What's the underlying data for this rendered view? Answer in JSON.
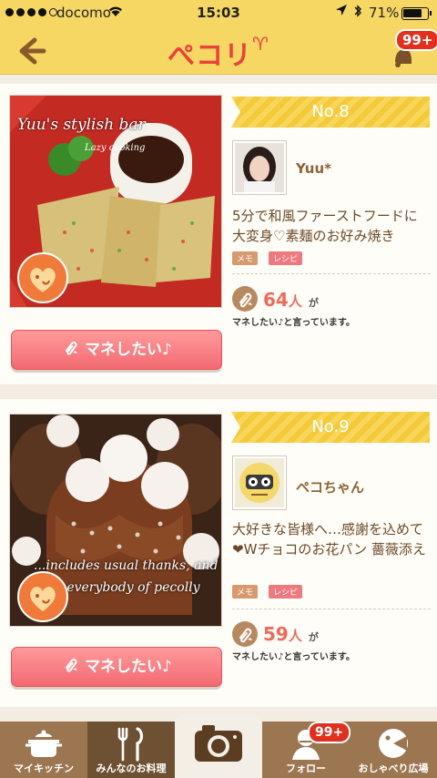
{
  "status_bar": {
    "carrier": "docomo",
    "time": "15:03",
    "battery": "71%"
  },
  "nav": {
    "logo": "ぺコリ",
    "notification_badge": "99+"
  },
  "posts": [
    {
      "rank": "No.8",
      "user": "Yuu*",
      "title": "5分で和風ファーストフードに大変身♡素麺のお好み焼き",
      "tag_memo": "メモ",
      "tag_recipe": "レシピ",
      "count": "64",
      "count_unit": "人",
      "count_suffix": "が",
      "count_text": "マネしたい♪と言っています。",
      "button_label": "マネしたい♪",
      "photo_caption_1": "Yuu's stylish bar",
      "photo_caption_2": "Lazy cooking"
    },
    {
      "rank": "No.9",
      "user": "ペコちゃん",
      "title": "大好きな皆様へ…感謝を込めて❤Wチョコのお花パン 薔薇添え",
      "tag_memo": "メモ",
      "tag_recipe": "レシピ",
      "count": "59",
      "count_unit": "人",
      "count_suffix": "が",
      "count_text": "マネしたい♪と言っています。",
      "button_label": "マネしたい♪",
      "photo_caption_1": "...includes usual thanks, and",
      "photo_caption_2": "to everybody of pecolly"
    }
  ],
  "tabbar": {
    "tabs": [
      {
        "label": "マイキッチン"
      },
      {
        "label": "みんなのお料理"
      },
      {
        "label": ""
      },
      {
        "label": "フォロー"
      },
      {
        "label": "おしゃべり広場"
      }
    ],
    "follow_badge": "99+"
  },
  "colors": {
    "header": "#f7d764",
    "accent": "#e8433a",
    "button": "#f26a72",
    "tabbar": "#9c7650"
  }
}
